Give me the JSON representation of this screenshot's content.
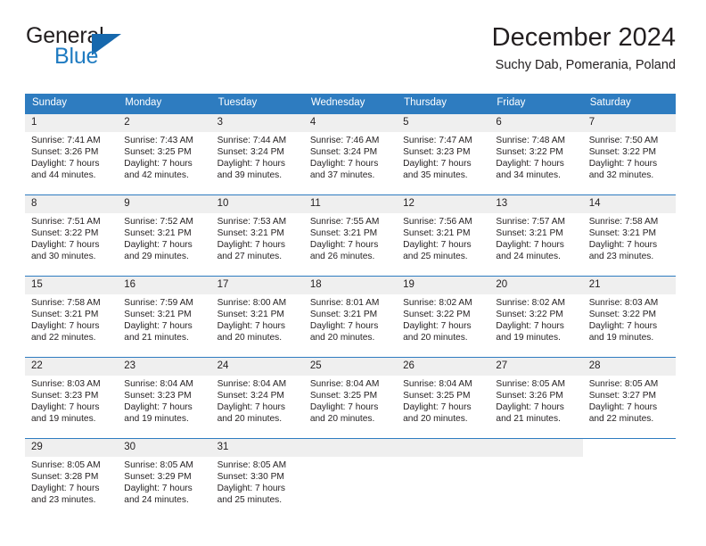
{
  "brand": {
    "word_one": "General",
    "word_two": "Blue",
    "logo_icon": "triangle-flag-icon"
  },
  "header": {
    "title": "December 2024",
    "location": "Suchy Dab, Pomerania, Poland"
  },
  "colors": {
    "accent_blue": "#2e7cc0",
    "brand_blue": "#1f7bc1",
    "logo_blue": "#1668ad",
    "daynum_band": "#efefef",
    "text": "#231f20"
  },
  "weekday_headers": [
    "Sunday",
    "Monday",
    "Tuesday",
    "Wednesday",
    "Thursday",
    "Friday",
    "Saturday"
  ],
  "calendar": {
    "weeks": [
      [
        {
          "day": "1",
          "sunrise": "Sunrise: 7:41 AM",
          "sunset": "Sunset: 3:26 PM",
          "daylight_line1": "Daylight: 7 hours",
          "daylight_line2": "and 44 minutes."
        },
        {
          "day": "2",
          "sunrise": "Sunrise: 7:43 AM",
          "sunset": "Sunset: 3:25 PM",
          "daylight_line1": "Daylight: 7 hours",
          "daylight_line2": "and 42 minutes."
        },
        {
          "day": "3",
          "sunrise": "Sunrise: 7:44 AM",
          "sunset": "Sunset: 3:24 PM",
          "daylight_line1": "Daylight: 7 hours",
          "daylight_line2": "and 39 minutes."
        },
        {
          "day": "4",
          "sunrise": "Sunrise: 7:46 AM",
          "sunset": "Sunset: 3:24 PM",
          "daylight_line1": "Daylight: 7 hours",
          "daylight_line2": "and 37 minutes."
        },
        {
          "day": "5",
          "sunrise": "Sunrise: 7:47 AM",
          "sunset": "Sunset: 3:23 PM",
          "daylight_line1": "Daylight: 7 hours",
          "daylight_line2": "and 35 minutes."
        },
        {
          "day": "6",
          "sunrise": "Sunrise: 7:48 AM",
          "sunset": "Sunset: 3:22 PM",
          "daylight_line1": "Daylight: 7 hours",
          "daylight_line2": "and 34 minutes."
        },
        {
          "day": "7",
          "sunrise": "Sunrise: 7:50 AM",
          "sunset": "Sunset: 3:22 PM",
          "daylight_line1": "Daylight: 7 hours",
          "daylight_line2": "and 32 minutes."
        }
      ],
      [
        {
          "day": "8",
          "sunrise": "Sunrise: 7:51 AM",
          "sunset": "Sunset: 3:22 PM",
          "daylight_line1": "Daylight: 7 hours",
          "daylight_line2": "and 30 minutes."
        },
        {
          "day": "9",
          "sunrise": "Sunrise: 7:52 AM",
          "sunset": "Sunset: 3:21 PM",
          "daylight_line1": "Daylight: 7 hours",
          "daylight_line2": "and 29 minutes."
        },
        {
          "day": "10",
          "sunrise": "Sunrise: 7:53 AM",
          "sunset": "Sunset: 3:21 PM",
          "daylight_line1": "Daylight: 7 hours",
          "daylight_line2": "and 27 minutes."
        },
        {
          "day": "11",
          "sunrise": "Sunrise: 7:55 AM",
          "sunset": "Sunset: 3:21 PM",
          "daylight_line1": "Daylight: 7 hours",
          "daylight_line2": "and 26 minutes."
        },
        {
          "day": "12",
          "sunrise": "Sunrise: 7:56 AM",
          "sunset": "Sunset: 3:21 PM",
          "daylight_line1": "Daylight: 7 hours",
          "daylight_line2": "and 25 minutes."
        },
        {
          "day": "13",
          "sunrise": "Sunrise: 7:57 AM",
          "sunset": "Sunset: 3:21 PM",
          "daylight_line1": "Daylight: 7 hours",
          "daylight_line2": "and 24 minutes."
        },
        {
          "day": "14",
          "sunrise": "Sunrise: 7:58 AM",
          "sunset": "Sunset: 3:21 PM",
          "daylight_line1": "Daylight: 7 hours",
          "daylight_line2": "and 23 minutes."
        }
      ],
      [
        {
          "day": "15",
          "sunrise": "Sunrise: 7:58 AM",
          "sunset": "Sunset: 3:21 PM",
          "daylight_line1": "Daylight: 7 hours",
          "daylight_line2": "and 22 minutes."
        },
        {
          "day": "16",
          "sunrise": "Sunrise: 7:59 AM",
          "sunset": "Sunset: 3:21 PM",
          "daylight_line1": "Daylight: 7 hours",
          "daylight_line2": "and 21 minutes."
        },
        {
          "day": "17",
          "sunrise": "Sunrise: 8:00 AM",
          "sunset": "Sunset: 3:21 PM",
          "daylight_line1": "Daylight: 7 hours",
          "daylight_line2": "and 20 minutes."
        },
        {
          "day": "18",
          "sunrise": "Sunrise: 8:01 AM",
          "sunset": "Sunset: 3:21 PM",
          "daylight_line1": "Daylight: 7 hours",
          "daylight_line2": "and 20 minutes."
        },
        {
          "day": "19",
          "sunrise": "Sunrise: 8:02 AM",
          "sunset": "Sunset: 3:22 PM",
          "daylight_line1": "Daylight: 7 hours",
          "daylight_line2": "and 20 minutes."
        },
        {
          "day": "20",
          "sunrise": "Sunrise: 8:02 AM",
          "sunset": "Sunset: 3:22 PM",
          "daylight_line1": "Daylight: 7 hours",
          "daylight_line2": "and 19 minutes."
        },
        {
          "day": "21",
          "sunrise": "Sunrise: 8:03 AM",
          "sunset": "Sunset: 3:22 PM",
          "daylight_line1": "Daylight: 7 hours",
          "daylight_line2": "and 19 minutes."
        }
      ],
      [
        {
          "day": "22",
          "sunrise": "Sunrise: 8:03 AM",
          "sunset": "Sunset: 3:23 PM",
          "daylight_line1": "Daylight: 7 hours",
          "daylight_line2": "and 19 minutes."
        },
        {
          "day": "23",
          "sunrise": "Sunrise: 8:04 AM",
          "sunset": "Sunset: 3:23 PM",
          "daylight_line1": "Daylight: 7 hours",
          "daylight_line2": "and 19 minutes."
        },
        {
          "day": "24",
          "sunrise": "Sunrise: 8:04 AM",
          "sunset": "Sunset: 3:24 PM",
          "daylight_line1": "Daylight: 7 hours",
          "daylight_line2": "and 20 minutes."
        },
        {
          "day": "25",
          "sunrise": "Sunrise: 8:04 AM",
          "sunset": "Sunset: 3:25 PM",
          "daylight_line1": "Daylight: 7 hours",
          "daylight_line2": "and 20 minutes."
        },
        {
          "day": "26",
          "sunrise": "Sunrise: 8:04 AM",
          "sunset": "Sunset: 3:25 PM",
          "daylight_line1": "Daylight: 7 hours",
          "daylight_line2": "and 20 minutes."
        },
        {
          "day": "27",
          "sunrise": "Sunrise: 8:05 AM",
          "sunset": "Sunset: 3:26 PM",
          "daylight_line1": "Daylight: 7 hours",
          "daylight_line2": "and 21 minutes."
        },
        {
          "day": "28",
          "sunrise": "Sunrise: 8:05 AM",
          "sunset": "Sunset: 3:27 PM",
          "daylight_line1": "Daylight: 7 hours",
          "daylight_line2": "and 22 minutes."
        }
      ],
      [
        {
          "day": "29",
          "sunrise": "Sunrise: 8:05 AM",
          "sunset": "Sunset: 3:28 PM",
          "daylight_line1": "Daylight: 7 hours",
          "daylight_line2": "and 23 minutes."
        },
        {
          "day": "30",
          "sunrise": "Sunrise: 8:05 AM",
          "sunset": "Sunset: 3:29 PM",
          "daylight_line1": "Daylight: 7 hours",
          "daylight_line2": "and 24 minutes."
        },
        {
          "day": "31",
          "sunrise": "Sunrise: 8:05 AM",
          "sunset": "Sunset: 3:30 PM",
          "daylight_line1": "Daylight: 7 hours",
          "daylight_line2": "and 25 minutes."
        },
        {
          "day": "",
          "sunrise": "",
          "sunset": "",
          "daylight_line1": "",
          "daylight_line2": "",
          "empty": true
        },
        {
          "day": "",
          "sunrise": "",
          "sunset": "",
          "daylight_line1": "",
          "daylight_line2": "",
          "empty": true
        },
        {
          "day": "",
          "sunrise": "",
          "sunset": "",
          "daylight_line1": "",
          "daylight_line2": "",
          "empty": true
        },
        {
          "day": "",
          "sunrise": "",
          "sunset": "",
          "daylight_line1": "",
          "daylight_line2": "",
          "empty": true
        }
      ]
    ]
  }
}
